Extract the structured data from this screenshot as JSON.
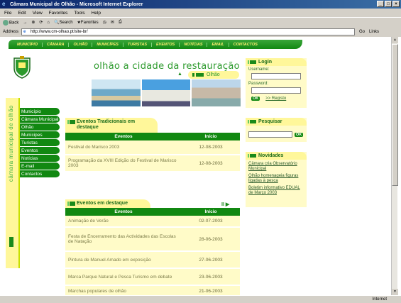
{
  "window": {
    "title": "Câmara Municipal de Olhão - Microsoft Internet Explorer",
    "menu": [
      "File",
      "Edit",
      "View",
      "Favorites",
      "Tools",
      "Help"
    ],
    "toolbar": [
      "Back",
      "Search",
      "Favorites"
    ],
    "address_label": "Address",
    "address_value": "http://www.cm-olhao.pt/site-br/",
    "go_label": "Go",
    "links_label": "Links"
  },
  "topnav": [
    "MUNICÍPIO",
    "CÂMARA",
    "OLHÃO",
    "MUNICÍPES",
    "TURISTAS",
    "EVENTOS",
    "NOTÍCIAS",
    "EMAIL",
    "CONTACTOS"
  ],
  "sidebar": {
    "vertical_text": "câmara municipal de olhão",
    "items": [
      "Município",
      "Câmara Municipal",
      "Olhão",
      "Munícipes",
      "Turistas",
      "Eventos",
      "Notícias",
      "E-mail",
      "Contactos"
    ]
  },
  "header": {
    "slogan": "olhão a cidade da restauração",
    "tag": "Olhão"
  },
  "eventos_tradicionais": {
    "title": "Eventos Tradicionais em destaque",
    "columns": [
      "Eventos",
      "Início"
    ],
    "rows": [
      {
        "event": "Festival do Marisco 2003",
        "date": "12-08-2003"
      },
      {
        "event": "Programação da XVIII Edição do Festival de Marisco 2003",
        "date": "12-08-2003"
      }
    ]
  },
  "eventos_destaque": {
    "title": "Eventos em destaque",
    "columns": [
      "Eventos",
      "Início"
    ],
    "rows": [
      {
        "event": "Animação de Verão",
        "date": "02-07-2003"
      },
      {
        "event": "Festa de Encerramento das Actividades das Escolas de Natação",
        "date": "28-06-2003"
      },
      {
        "event": "Pintura de Manuel Amado em exposição",
        "date": "27-06-2003"
      },
      {
        "event": "Marca Parque Natural e Pesca Turismo em debate",
        "date": "23-06-2003"
      },
      {
        "event": "Marchas populares de olhão",
        "date": "21-06-2003"
      }
    ]
  },
  "login": {
    "title": "Login",
    "username_label": "Username:",
    "password_label": "Password:",
    "ok_label": "OK",
    "register_link": ">> Registo"
  },
  "pesquisar": {
    "title": "Pesquisar",
    "ok_label": "OK"
  },
  "novidades": {
    "title": "Novidades",
    "links": [
      "Câmara cria Observatório Municipal",
      "Olhão homenageia figuras ligadas à pesca",
      "Boletim informativo EDUAL de Março 2003"
    ]
  },
  "status": {
    "text": "",
    "zone": "Internet"
  },
  "colors": {
    "brand_green": "#118811",
    "light_yellow": "#fff79a",
    "cell_yellow": "#fffbc8",
    "title_blue": "#0a246a"
  }
}
